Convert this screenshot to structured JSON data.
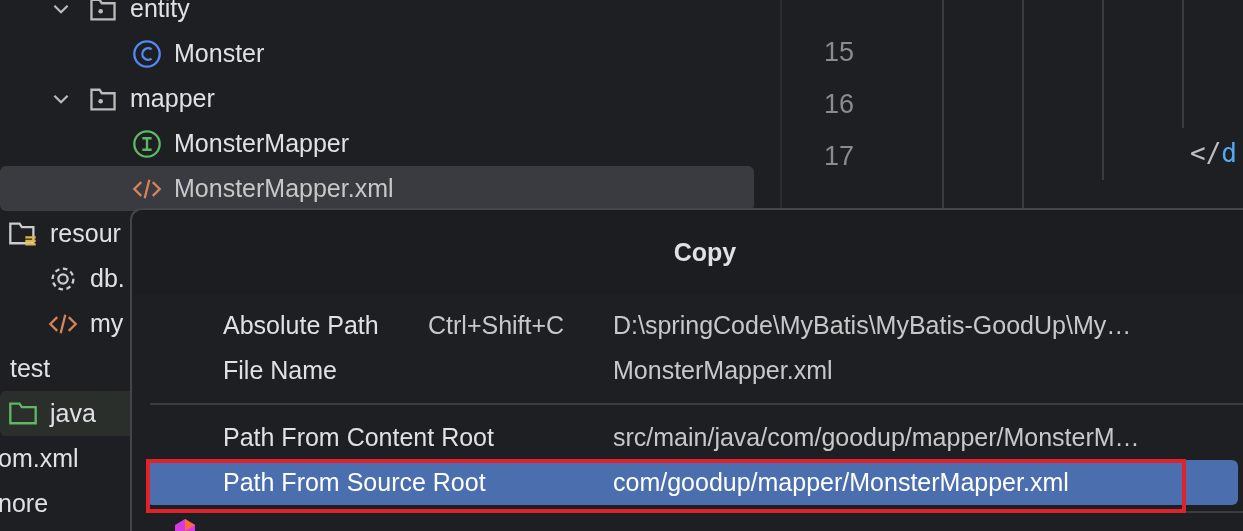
{
  "project_tree": [
    {
      "label": "entity",
      "kind": "package",
      "expanded": true,
      "selected": false,
      "children": [
        {
          "label": "Monster",
          "kind": "class",
          "selected": false
        }
      ]
    },
    {
      "label": "mapper",
      "kind": "package",
      "expanded": true,
      "selected": false,
      "children": [
        {
          "label": "MonsterMapper",
          "kind": "interface",
          "selected": false
        },
        {
          "label": "MonsterMapper.xml",
          "kind": "xml",
          "selected": true
        }
      ]
    }
  ],
  "tree_below": [
    {
      "label": "resour",
      "kind": "resources",
      "selected": false
    },
    {
      "label": "db.",
      "kind": "properties",
      "selected": false
    },
    {
      "label": "my",
      "kind": "xml",
      "selected": false
    },
    {
      "label": "test",
      "kind": "cut",
      "selected": false
    },
    {
      "label": "java",
      "kind": "testfolder",
      "selected": true
    },
    {
      "label": "om.xml",
      "kind": "none",
      "selected": false
    },
    {
      "label": "nore",
      "kind": "none",
      "selected": false
    }
  ],
  "editor": {
    "line_numbers": [
      "15",
      "16",
      "17"
    ],
    "code": [
      {
        "punct": "</",
        "tag": "d"
      }
    ]
  },
  "popup": {
    "title": "Copy",
    "groups": [
      [
        {
          "name": "Absolute Path",
          "shortcut": "Ctrl+Shift+C",
          "value": "D:\\springCode\\MyBatis\\MyBatis-GoodUp\\My…",
          "selected": false
        },
        {
          "name": "File Name",
          "value": "MonsterMapper.xml",
          "selected": false
        }
      ],
      [
        {
          "name": "Path From Content Root",
          "value": "src/main/java/com/goodup/mapper/MonsterM…",
          "selected": false
        },
        {
          "name": "Path From Source Root",
          "value": "com/goodup/mapper/MonsterMapper.xml",
          "selected": true,
          "highlighted": true
        }
      ]
    ]
  }
}
